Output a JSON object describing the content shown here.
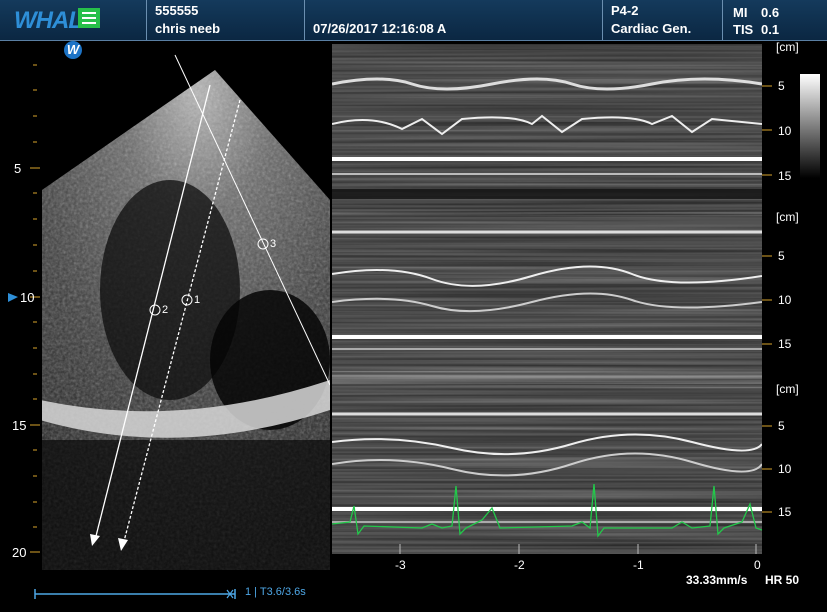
{
  "header": {
    "logo": "WHALE",
    "logo_badge": "W",
    "patient_id": "555555",
    "patient_name": "chris  neeb",
    "datetime": "07/26/2017  12:16:08 A",
    "probe": "P4-2",
    "preset": "Cardiac Gen.",
    "mi_label": "MI",
    "mi_value": "0.6",
    "tis_label": "TIS",
    "tis_value": "0.1"
  },
  "left_scale": {
    "ticks": [
      "5",
      "10",
      "15",
      "20"
    ]
  },
  "mmode_lines": {
    "markers": [
      "1",
      "2",
      "3"
    ]
  },
  "right_scales": [
    {
      "unit": "[cm]",
      "ticks": [
        "5",
        "10",
        "15"
      ]
    },
    {
      "unit": "[cm]",
      "ticks": [
        "5",
        "10",
        "15"
      ]
    },
    {
      "unit": "[cm]",
      "ticks": [
        "5",
        "10",
        "15"
      ]
    }
  ],
  "time_axis": {
    "ticks": [
      "-3",
      "-2",
      "-1",
      "0"
    ]
  },
  "footer": {
    "trace_info": "1 | T3.6/3.6s",
    "sweep_speed": "33.33mm/s",
    "heart_rate": "HR 50"
  },
  "colors": {
    "header_bg": "#0b2742",
    "ecg": "#22c94a",
    "accent": "#2e8fd8"
  }
}
